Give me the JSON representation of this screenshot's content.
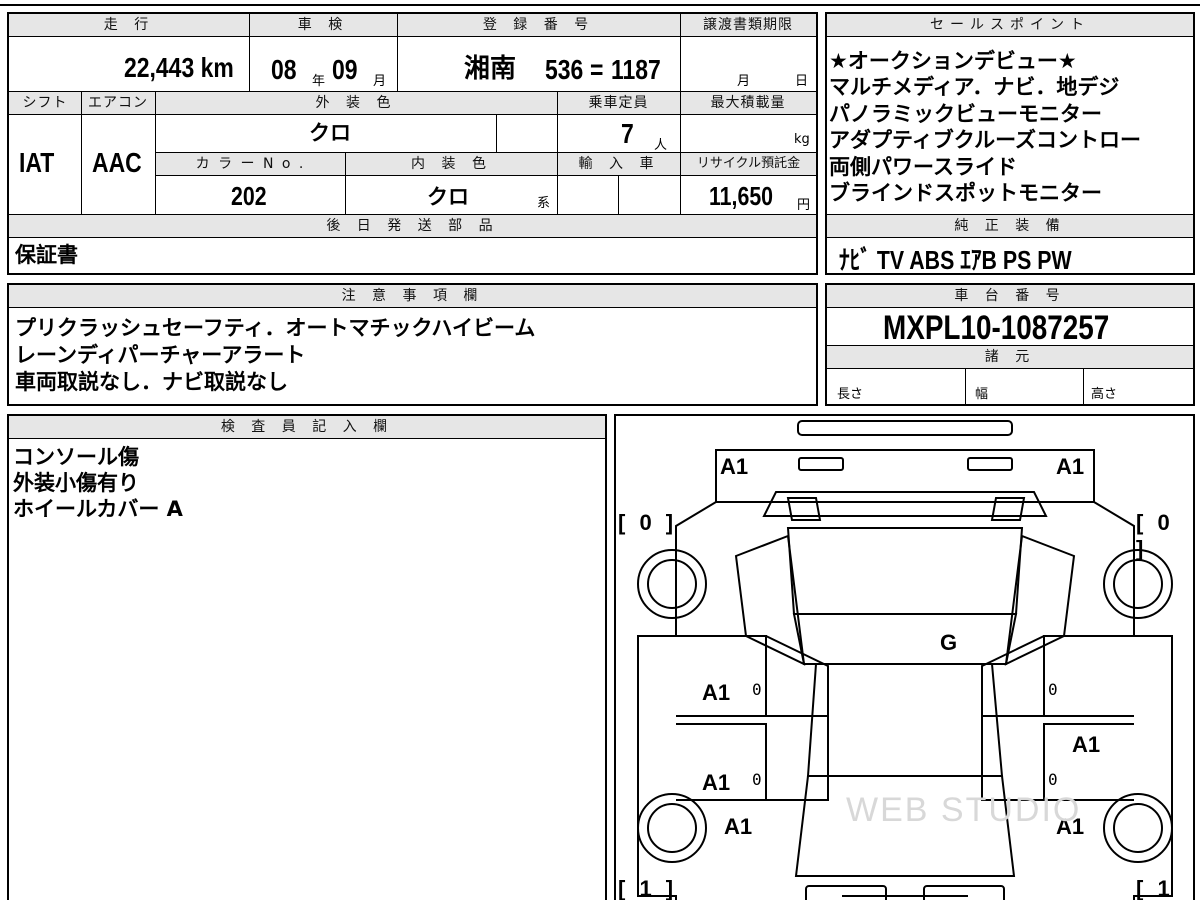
{
  "header": {
    "mileage_label": "走 行",
    "shaken_label": "車 検",
    "reg_label": "登 録 番 号",
    "transfer_label": "譲渡書類期限",
    "sales_label": "セールスポイント"
  },
  "mileage": "22,443 km",
  "shaken": {
    "year": "08",
    "year_unit": "年",
    "month": "09",
    "month_unit": "月"
  },
  "registration": {
    "region": "湘南",
    "number": "536",
    "sep": "=",
    "serial": "1187"
  },
  "transfer": {
    "month_unit": "月",
    "day_unit": "日"
  },
  "row2": {
    "shift_label": "シフト",
    "ac_label": "エアコン",
    "ext_color_label": "外 装 色",
    "capacity_label": "乗車定員",
    "max_load_label": "最大積載量",
    "shift": "IAT",
    "ac": "AAC",
    "ext_color": "クロ",
    "capacity": "7",
    "capacity_unit": "人",
    "load_unit": "kg",
    "color_no_label": "カ ラ ー N o .",
    "int_color_label": "内 装 色",
    "import_label": "輸 入 車",
    "recycle_label": "リサイクル預託金",
    "color_no": "202",
    "int_color": "クロ",
    "int_suffix": "系",
    "recycle": "11,650",
    "recycle_unit": "円"
  },
  "sales_points": [
    "★オークションデビュー★",
    "マルチメディア．ナビ．地デジ",
    "パノラミックビューモニター",
    "アダプティブクルーズコントロー",
    "両側パワースライド",
    "ブラインドスポットモニター"
  ],
  "later_parts": {
    "label": "後 日 発 送 部 品",
    "value": "保証書"
  },
  "equipment": {
    "label": "純 正 装 備",
    "value": "ﾅﾋﾞ TV ABS ｴｱB PS PW"
  },
  "notes": {
    "label": "注 意 事 項 欄",
    "lines": [
      "プリクラッシュセーフティ．オートマチックハイビーム",
      "レーンディパーチャーアラート",
      "車両取説なし．ナビ取説なし"
    ]
  },
  "chassis": {
    "label": "車 台 番 号",
    "value": "MXPL10-1087257"
  },
  "specs": {
    "label": "諸 元",
    "length": "長さ",
    "width": "幅",
    "height": "高さ"
  },
  "inspector": {
    "label": "検 査 員 記 入 欄",
    "lines": [
      "コンソール傷",
      "外装小傷有り",
      "ホイールカバー A"
    ]
  },
  "diagram": {
    "front_left": "A1",
    "front_right": "A1",
    "bracket_tl": "[ 0 ]",
    "bracket_tr": "[ 0 ]",
    "bracket_bl": "[ 1 ]",
    "bracket_br": "[ 1 ]",
    "glass": "G",
    "left_door_front": "A1",
    "left_door_rear": "A1",
    "right_door_rear": "A1",
    "left_wheel_rear": "A1",
    "right_wheel_rear": "A1",
    "small_zero": "0",
    "watermark": "WEB STUDIO"
  }
}
